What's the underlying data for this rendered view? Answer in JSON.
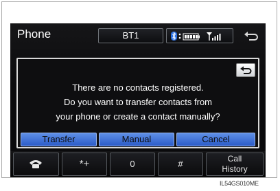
{
  "header": {
    "title": "Phone",
    "device_name": "BT1"
  },
  "dialog": {
    "message_lines": [
      "There are no contacts registered.",
      "Do you want to transfer contacts from",
      "your phone or create a contact manually?"
    ],
    "buttons": {
      "transfer": "Transfer",
      "manual": "Manual",
      "cancel": "Cancel"
    }
  },
  "bottom_bar": {
    "keypad_label": "*+",
    "zero_label": "0",
    "hash_label": "#",
    "call_history_line1": "Call",
    "call_history_line2": "History"
  },
  "caption": "IL54GS010ME",
  "icons": {
    "bluetooth": "bluetooth-icon",
    "battery": "battery-icon",
    "signal": "signal-icon",
    "back": "back-arrow-icon",
    "phone": "phone-handset-icon"
  },
  "colors": {
    "accent_button": "#3f6fd8",
    "screen_background": "#0b0b0d"
  }
}
